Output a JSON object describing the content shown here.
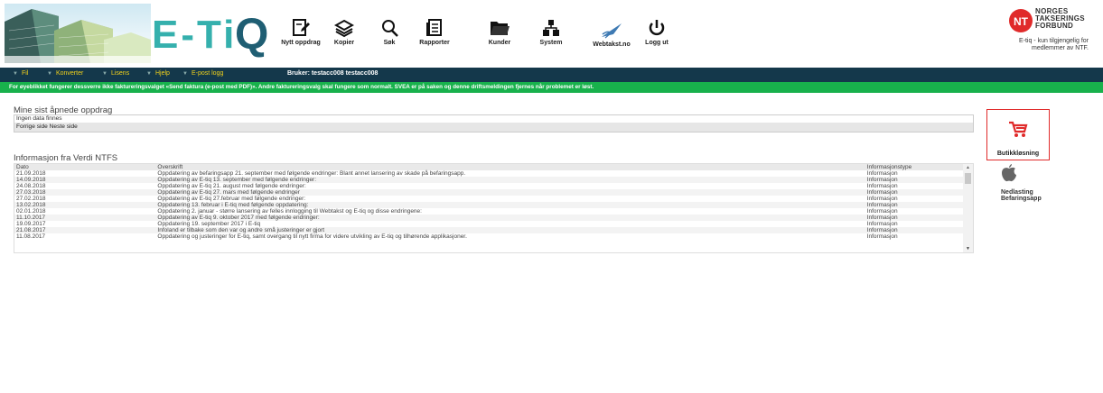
{
  "app": {
    "logo_text": "E-Ti",
    "logo_q": "Q"
  },
  "toolbar": [
    {
      "label": "Nytt oppdrag",
      "icon": "new-order-icon"
    },
    {
      "label": "Kopier",
      "icon": "layers-icon"
    },
    {
      "label": "Søk",
      "icon": "search-icon"
    },
    {
      "label": "Rapporter",
      "icon": "report-icon"
    },
    {
      "label": "Kunder",
      "icon": "folder-icon"
    },
    {
      "label": "System",
      "icon": "network-icon"
    },
    {
      "label": "Webtakst.no",
      "icon": "plane-icon"
    },
    {
      "label": "Logg ut",
      "icon": "power-icon"
    }
  ],
  "partner": {
    "name_lines": [
      "NORGES",
      "TAKSERINGS",
      "FORBUND"
    ],
    "subtitle": "E-tiq - kun tilgjengelig for medlemmer av NTF."
  },
  "menu": [
    {
      "label": "Fil"
    },
    {
      "label": "Konverter"
    },
    {
      "label": "Lisens"
    },
    {
      "label": "Hjelp"
    },
    {
      "label": "E-post logg"
    }
  ],
  "user_info": "Bruker: testacc008 testacc008",
  "notice": "For øyeblikket fungerer dessverre ikke faktureringsvalget «Send faktura (e-post med PDF)». Andre faktureringsvalg skal fungere som normalt. SVEA er på saken og denne driftsmeldingen fjernes når problemet er løst.",
  "recent": {
    "title": "Mine sist åpnede oppdrag",
    "empty_text": "Ingen data finnes",
    "prev": "Forrige side",
    "next": "Neste side"
  },
  "news": {
    "title": "Informasjon fra Verdi NTFS",
    "columns": [
      "Dato",
      "Overskrift",
      "Informasjonstype"
    ],
    "rows": [
      [
        "21.09.2018",
        "Oppdatering av befaringsapp 21. september med følgende endringer: Blant annet lansering av skade på befaringsapp.",
        "Informasjon"
      ],
      [
        "14.09.2018",
        "Oppdatering av E-tiq 13. september med følgende endringer:",
        "Informasjon"
      ],
      [
        "24.08.2018",
        "Oppdatering av E-tiq 21. august med følgende endringer:",
        "Informasjon"
      ],
      [
        "27.03.2018",
        "Oppdatering av E-tiq 27. mars med følgende endringer",
        "Informasjon"
      ],
      [
        "27.02.2018",
        "Oppdatering av E-tiq 27.februar med følgende endringer:",
        "Informasjon"
      ],
      [
        "13.02.2018",
        "Oppdatering 13. februar i E-tiq med følgende oppdatering:",
        "Informasjon"
      ],
      [
        "02.01.2018",
        "Oppdatering 2. januar - større lansering av felles innlogging til Webtakst og E-tiq og disse endringene:",
        "Informasjon"
      ],
      [
        "11.10.2017",
        "Oppdatering av E-tiq 9. oktober 2017 med følgende endringer:",
        "Informasjon"
      ],
      [
        "19.09.2017",
        "Oppdatering 19. september 2017 i E-tiq",
        "Informasjon"
      ],
      [
        "21.08.2017",
        "Infoland er tilbake som den var og andre små justeringer er gjort",
        "Informasjon"
      ],
      [
        "11.08.2017",
        "Oppdatering og justeringer for E-tiq, samt overgang til nytt firma for videre utvikling av E-tiq og tilhørende applikasjoner.",
        "Informasjon"
      ]
    ]
  },
  "side": {
    "shop_label": "Butikkløsning",
    "app_label_lines": [
      "Nedlasting",
      "Befaringsapp"
    ]
  },
  "colors": {
    "menubar": "#14384b",
    "menu_text": "#f3d21b",
    "notice_bg": "#18b14c",
    "logo_teal": "#35b0ad",
    "logo_dark": "#1f5e73",
    "accent_red": "#e02a2a"
  }
}
